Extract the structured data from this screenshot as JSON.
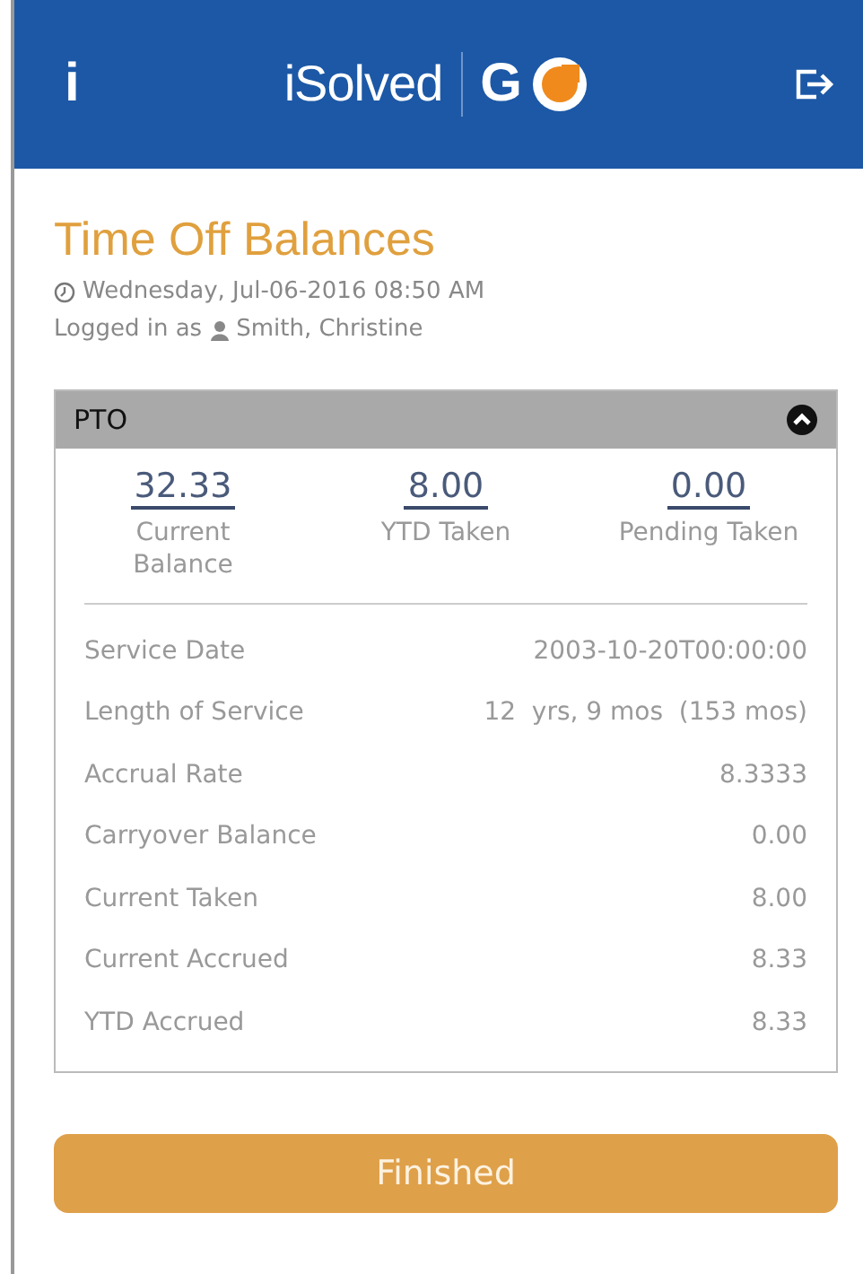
{
  "header": {
    "info": "i",
    "brand": "iSolved",
    "logo_letter": "G"
  },
  "title": "Time Off Balances",
  "datetime": "Wednesday, Jul-06-2016 08:50 AM",
  "login": {
    "prefix": "Logged in as ",
    "user": "Smith, Christine"
  },
  "plan": {
    "name": "PTO",
    "expanded": true,
    "summary": [
      {
        "value": "32.33",
        "label": "Current Balance"
      },
      {
        "value": "8.00",
        "label": "YTD Taken"
      },
      {
        "value": "0.00",
        "label": "Pending Taken"
      }
    ],
    "details": [
      {
        "label": "Service Date",
        "value": "2003-10-20T00:00:00"
      },
      {
        "label": "Length of Service",
        "value": "12  yrs, 9 mos  (153 mos)"
      },
      {
        "label": "Accrual Rate",
        "value": "8.3333"
      },
      {
        "label": "Carryover Balance",
        "value": "0.00"
      },
      {
        "label": "Current Taken",
        "value": "8.00"
      },
      {
        "label": "Current Accrued",
        "value": "8.33"
      },
      {
        "label": "YTD Accrued",
        "value": "8.33"
      }
    ]
  },
  "button": "Finished"
}
